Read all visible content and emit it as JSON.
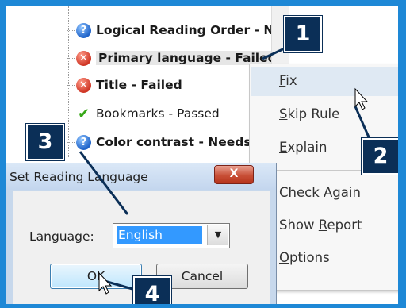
{
  "tree": {
    "items": [
      {
        "label": "Logical Reading Order - Ne",
        "icon": "question-icon",
        "bold": true
      },
      {
        "label": "Primary language - Failed",
        "icon": "failed-icon",
        "bold": true,
        "selected": true
      },
      {
        "label": "Title - Failed",
        "icon": "failed-icon",
        "bold": true
      },
      {
        "label": "Bookmarks - Passed",
        "icon": "checkmark-icon",
        "bold": false
      },
      {
        "label": "Color contrast - Needs r",
        "icon": "question-icon",
        "bold": true
      }
    ]
  },
  "context_menu": {
    "items": [
      {
        "label": "Fix",
        "underline": "F",
        "highlighted": true
      },
      {
        "label": "Skip Rule",
        "underline": "S"
      },
      {
        "label": "Explain",
        "underline": "E"
      },
      {
        "label": "Check Again",
        "underline": "C"
      },
      {
        "label": "Show Report",
        "underline": "R"
      },
      {
        "label": "Options",
        "underline": "O"
      }
    ]
  },
  "dialog": {
    "title": "Set Reading Language",
    "close_glyph": "X",
    "language_label": "Language:",
    "language_value": "English",
    "ok_label": "OK",
    "cancel_label": "Cancel"
  },
  "callouts": [
    "1",
    "2",
    "3",
    "4"
  ],
  "colors": {
    "frame_border": "#1e88d6",
    "badge_bg": "#0b2f57",
    "selection_blue": "#3399ff",
    "failed_red": "#cf3524",
    "question_blue": "#1f63c9",
    "passed_green": "#37a818"
  }
}
